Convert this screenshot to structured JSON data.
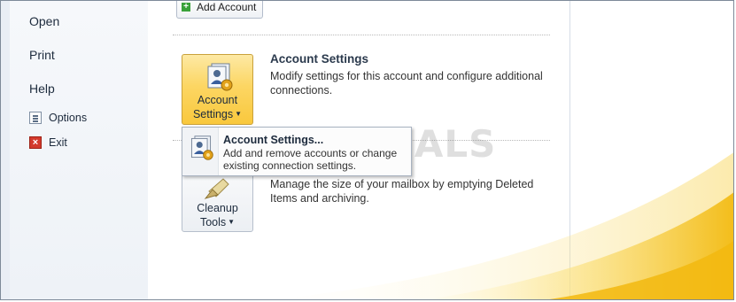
{
  "nav": {
    "open": "Open",
    "print": "Print",
    "help": "Help",
    "options": "Options",
    "exit": "Exit"
  },
  "toolbar": {
    "add_account": "Add Account"
  },
  "account_settings": {
    "button_line1": "Account",
    "button_line2": "Settings",
    "title": "Account Settings",
    "description": "Modify settings for this account and configure additional connections."
  },
  "dropdown": {
    "item_title": "Account Settings...",
    "item_desc": "Add and remove accounts or change existing connection settings."
  },
  "cleanup": {
    "button_line1": "Cleanup",
    "button_line2": "Tools",
    "description": "Manage the size of your mailbox by emptying Deleted Items and archiving."
  },
  "watermark": "APPUALS",
  "icons": {
    "add": "plus-icon",
    "account_settings": "people-gear-icon",
    "cleanup": "broom-icon",
    "options": "document-icon",
    "exit": "close-icon"
  },
  "colors": {
    "selected_button": "#fcd663",
    "swoosh": "#f6c623"
  }
}
